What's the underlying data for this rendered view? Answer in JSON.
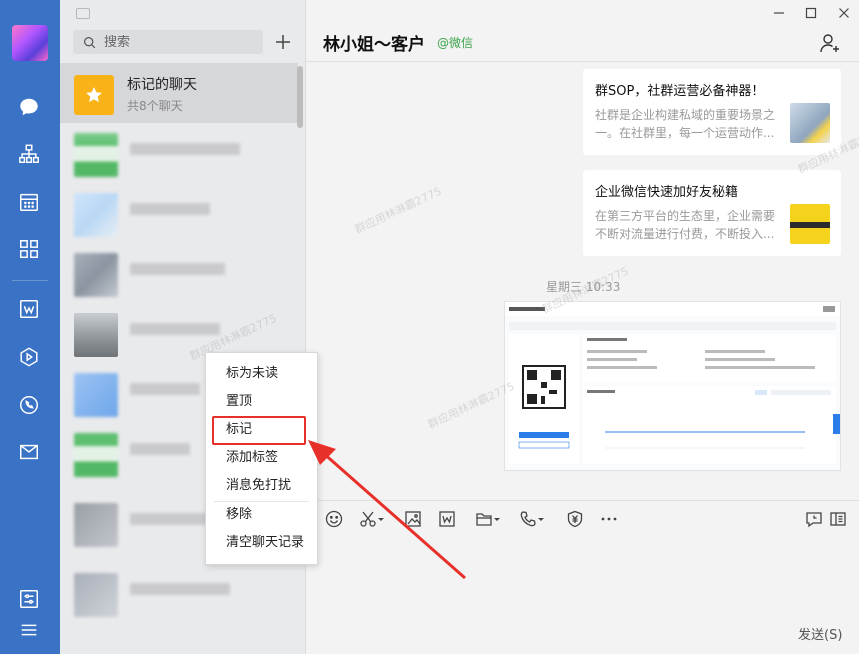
{
  "rail": {
    "icons": [
      "chat-icon",
      "org-icon",
      "calendar-icon",
      "apps-icon",
      "doc-icon",
      "drive-icon",
      "phone-icon",
      "mail-icon",
      "settings-icon",
      "menu-icon"
    ]
  },
  "search": {
    "placeholder": "搜索"
  },
  "starred": {
    "title": "标记的聊天",
    "subtitle": "共8个聊天"
  },
  "chat": {
    "name": "林小姐～客户",
    "tag": "@微信"
  },
  "cards": [
    {
      "title": "群SOP，社群运营必备神器！",
      "desc": "社群是企业构建私域的重要场景之一。在社群里，每一个运营动作..."
    },
    {
      "title": "企业微信快速加好友秘籍",
      "desc": "在第三方平台的生态里，企业需要不断对流量进行付费，不断投入..."
    }
  ],
  "timestamp": "星期三 10:33",
  "send_label": "发送(S)",
  "watermark": "群应用林淋霸2775",
  "context_menu": {
    "items": [
      "标为未读",
      "置顶",
      "标记",
      "添加标签",
      "消息免打扰",
      "移除",
      "清空聊天记录"
    ],
    "highlighted": "标记"
  },
  "colors": {
    "rail": "#3a73c6",
    "star": "#f9b317",
    "tag": "#3aa34b",
    "highlight": "#e8302a"
  }
}
